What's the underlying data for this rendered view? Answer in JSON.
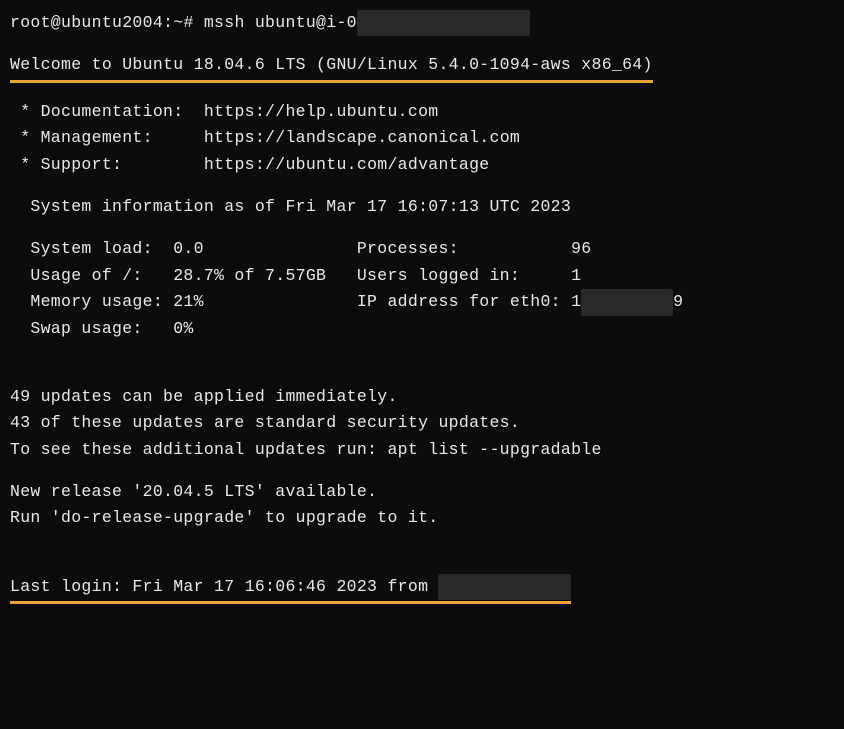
{
  "prompt": {
    "user_host": "root@ubuntu2004",
    "path": "~",
    "symbol": "#",
    "command": "mssh ubuntu@i-0",
    "redacted": "                 "
  },
  "welcome": "Welcome to Ubuntu 18.04.6 LTS (GNU/Linux 5.4.0-1094-aws x86_64)",
  "links": {
    "doc_label": " * Documentation:  ",
    "doc_url": "https://help.ubuntu.com",
    "mgmt_label": " * Management:     ",
    "mgmt_url": "https://landscape.canonical.com",
    "support_label": " * Support:        ",
    "support_url": "https://ubuntu.com/advantage"
  },
  "sysinfo": {
    "header": "  System information as of Fri Mar 17 16:07:13 UTC 2023",
    "line1": "  System load:  0.0               Processes:           96",
    "line2": "  Usage of /:   28.7% of 7.57GB   Users logged in:     1",
    "line3a": "  Memory usage: 21%               IP address for eth0: 1",
    "line3b_redacted": "         ",
    "line3c": "9",
    "line4": "  Swap usage:   0%"
  },
  "updates": {
    "line1": "49 updates can be applied immediately.",
    "line2": "43 of these updates are standard security updates.",
    "line3": "To see these additional updates run: apt list --upgradable"
  },
  "release": {
    "line1": "New release '20.04.5 LTS' available.",
    "line2": "Run 'do-release-upgrade' to upgrade to it."
  },
  "lastlogin": {
    "prefix": "Last login: Fri Mar 17 16:06:46 2023 from ",
    "redacted": "             "
  }
}
